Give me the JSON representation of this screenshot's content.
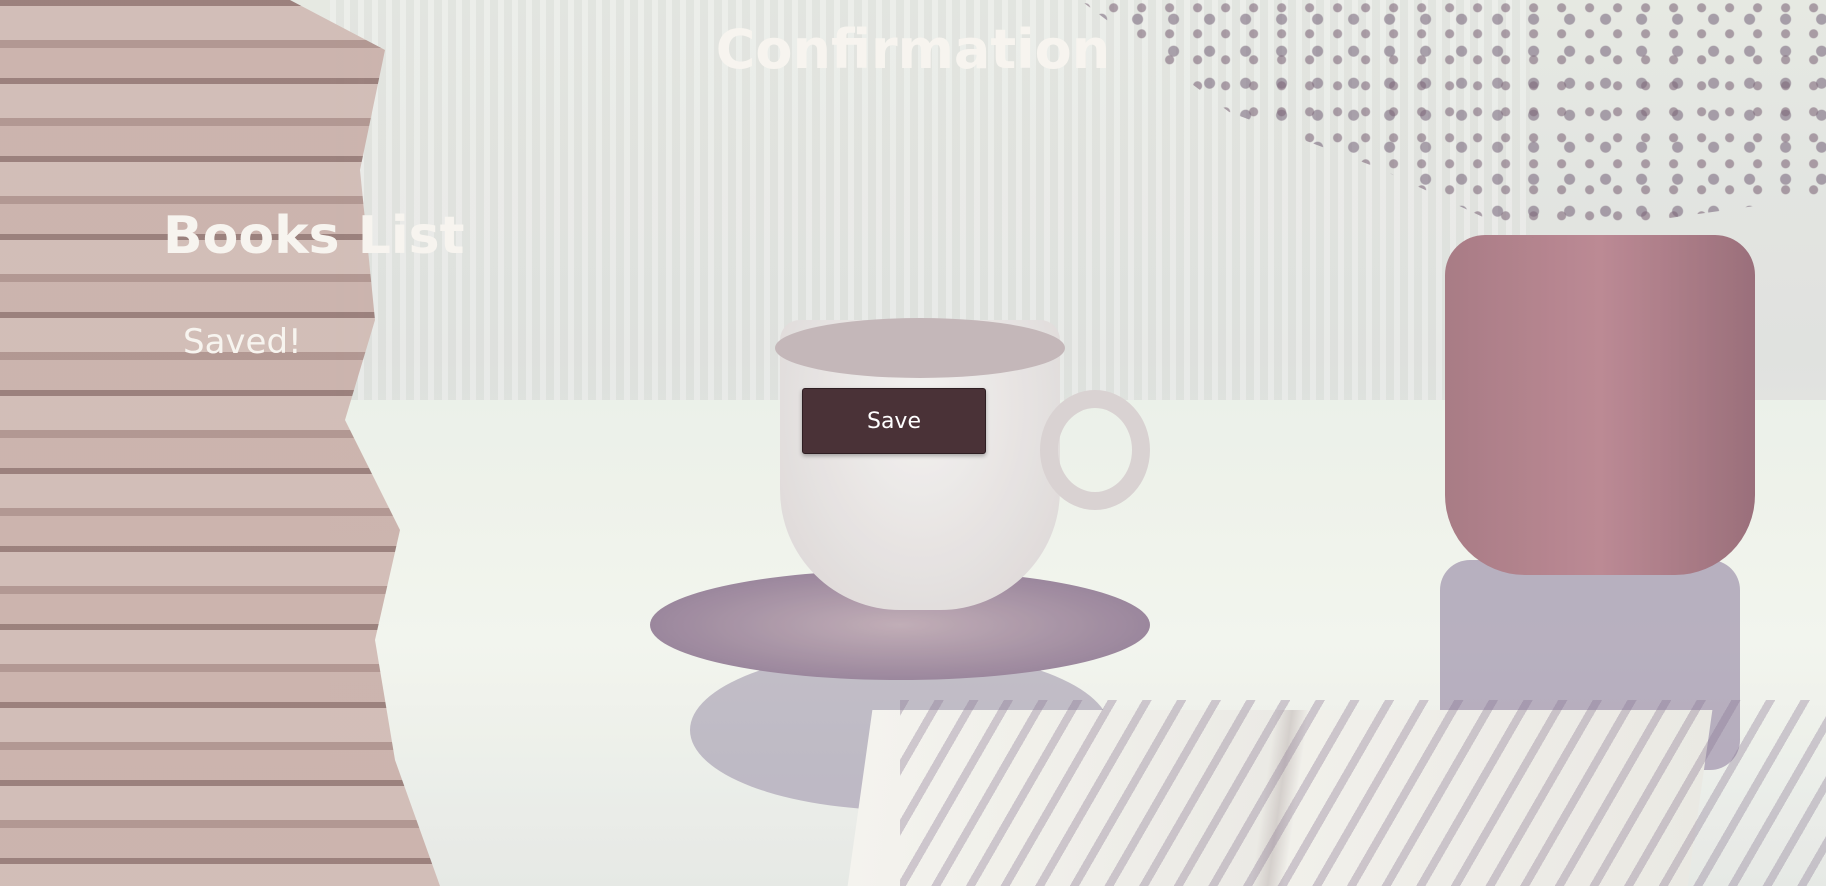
{
  "header": {
    "title": "Confirmation"
  },
  "main": {
    "list_title": "Books List",
    "status_message": "Saved!",
    "save_label": "Save"
  }
}
